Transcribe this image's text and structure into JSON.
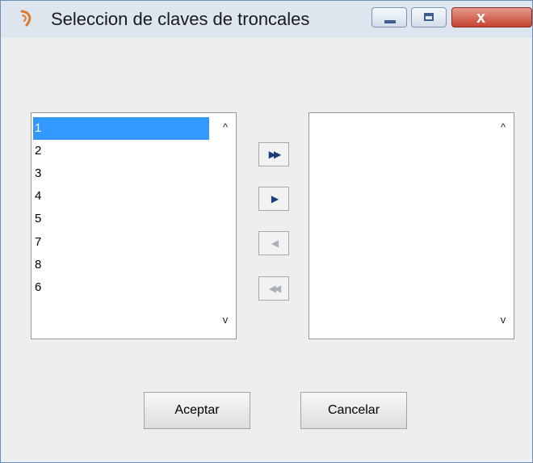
{
  "window": {
    "title": "Seleccion de claves de troncales",
    "controls": {
      "minimize_icon": "minimize-icon",
      "maximize_icon": "maximize-icon",
      "close_icon": "close-icon",
      "close_glyph": "x"
    }
  },
  "left_list": {
    "items": [
      "1",
      "2",
      "3",
      "4",
      "5",
      "7",
      "8",
      "6"
    ],
    "selected": "1",
    "scroll_up": "^",
    "scroll_down": "v"
  },
  "right_list": {
    "items": [],
    "scroll_up": "^",
    "scroll_down": "v"
  },
  "move_buttons": {
    "add_all": "▶▶",
    "add_one": "▶",
    "remove_one": "◀",
    "remove_all": "◀◀"
  },
  "buttons": {
    "accept": "Aceptar",
    "cancel": "Cancelar"
  },
  "colors": {
    "selection": "#3399ff",
    "title_bar": "#dde5ee",
    "close_button": "#c5422f"
  }
}
